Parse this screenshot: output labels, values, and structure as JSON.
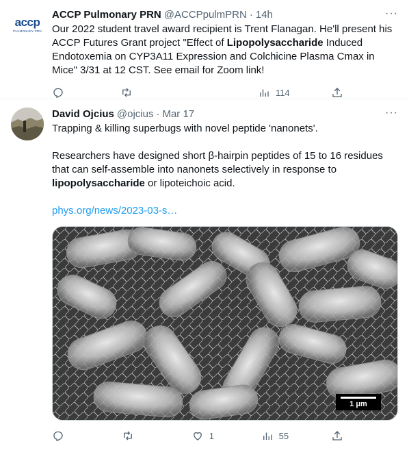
{
  "tweets": [
    {
      "name": "ACCP Pulmonary PRN",
      "handle": "@ACCPpulmPRN",
      "time": "14h",
      "avatar": {
        "logo": "accp",
        "sub": "PULMONARY PRN"
      },
      "text_parts": [
        "Our 2022 student travel award recipient is Trent Flanagan. He'll present his ACCP Futures Grant project \"Effect of ",
        "Lipopolysaccharide",
        " Induced Endotoxemia on CYP3A11 Expression and Colchicine Plasma Cmax in Mice\" 3/31 at 12 CST. See email for Zoom link!"
      ],
      "actions": {
        "reply": "",
        "retweet": "",
        "like": "",
        "views": "114"
      }
    },
    {
      "name": "David Ojcius",
      "handle": "@ojcius",
      "time": "Mar 17",
      "para1": "Trapping & killing superbugs with novel peptide 'nanonets'.",
      "para2_parts": [
        "Researchers have designed short β-hairpin peptides of 15 to 16 residues that can self-assemble into nanonets selectively in response to ",
        "lipopolysaccharide",
        " or lipoteichoic acid."
      ],
      "link": "phys.org/news/2023-03-s…",
      "media": {
        "scale_label": "1 μm"
      },
      "actions": {
        "reply": "",
        "retweet": "",
        "like": "1",
        "views": "55"
      }
    }
  ],
  "dot": "·",
  "more_label": "···"
}
